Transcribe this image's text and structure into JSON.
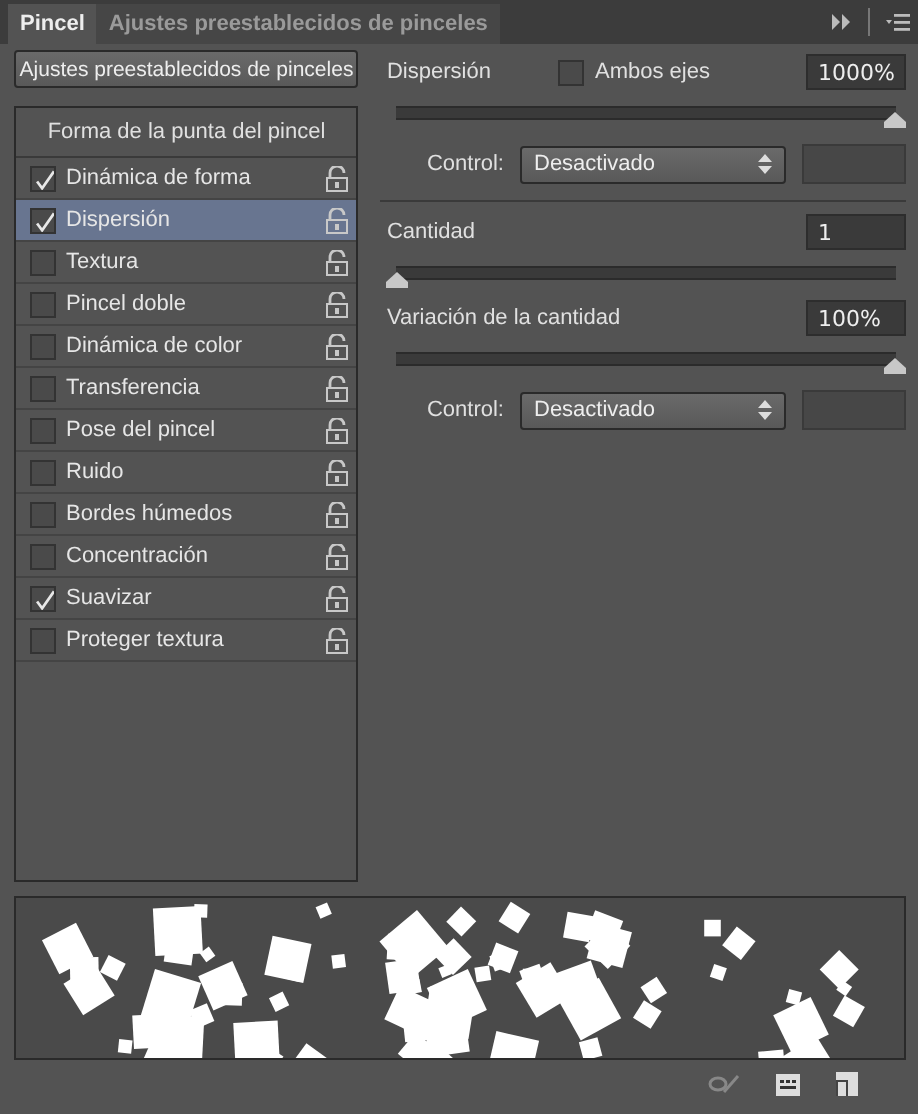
{
  "tabs": [
    {
      "label": "Pincel",
      "selected": true
    },
    {
      "label": "Ajustes preestablecidos de pinceles",
      "selected": false
    }
  ],
  "presets_button": "Ajustes preestablecidos de pinceles",
  "brush_list": {
    "header": "Forma de la punta del pincel",
    "items": [
      {
        "label": "Dinámica de forma",
        "checked": true,
        "selected": false
      },
      {
        "label": "Dispersión",
        "checked": true,
        "selected": true
      },
      {
        "label": "Textura",
        "checked": false,
        "selected": false
      },
      {
        "label": "Pincel doble",
        "checked": false,
        "selected": false
      },
      {
        "label": "Dinámica de color",
        "checked": false,
        "selected": false
      },
      {
        "label": "Transferencia",
        "checked": false,
        "selected": false
      },
      {
        "label": "Pose del pincel",
        "checked": false,
        "selected": false
      },
      {
        "label": "Ruido",
        "checked": false,
        "selected": false
      },
      {
        "label": "Bordes húmedos",
        "checked": false,
        "selected": false
      },
      {
        "label": "Concentración",
        "checked": false,
        "selected": false
      },
      {
        "label": "Suavizar",
        "checked": true,
        "selected": false
      },
      {
        "label": "Proteger textura",
        "checked": false,
        "selected": false
      }
    ]
  },
  "scatter": {
    "label": "Dispersión",
    "both_axes": {
      "label": "Ambos ejes",
      "checked": false
    },
    "value": "1000%",
    "level": 1,
    "control": {
      "label": "Control:",
      "value": "Desactivado"
    }
  },
  "count": {
    "label": "Cantidad",
    "value": "1",
    "level": 0
  },
  "count_jitter": {
    "label": "Variación de la cantidad",
    "value": "100%",
    "level": 1,
    "control": {
      "label": "Control:",
      "value": "Desactivado"
    }
  }
}
